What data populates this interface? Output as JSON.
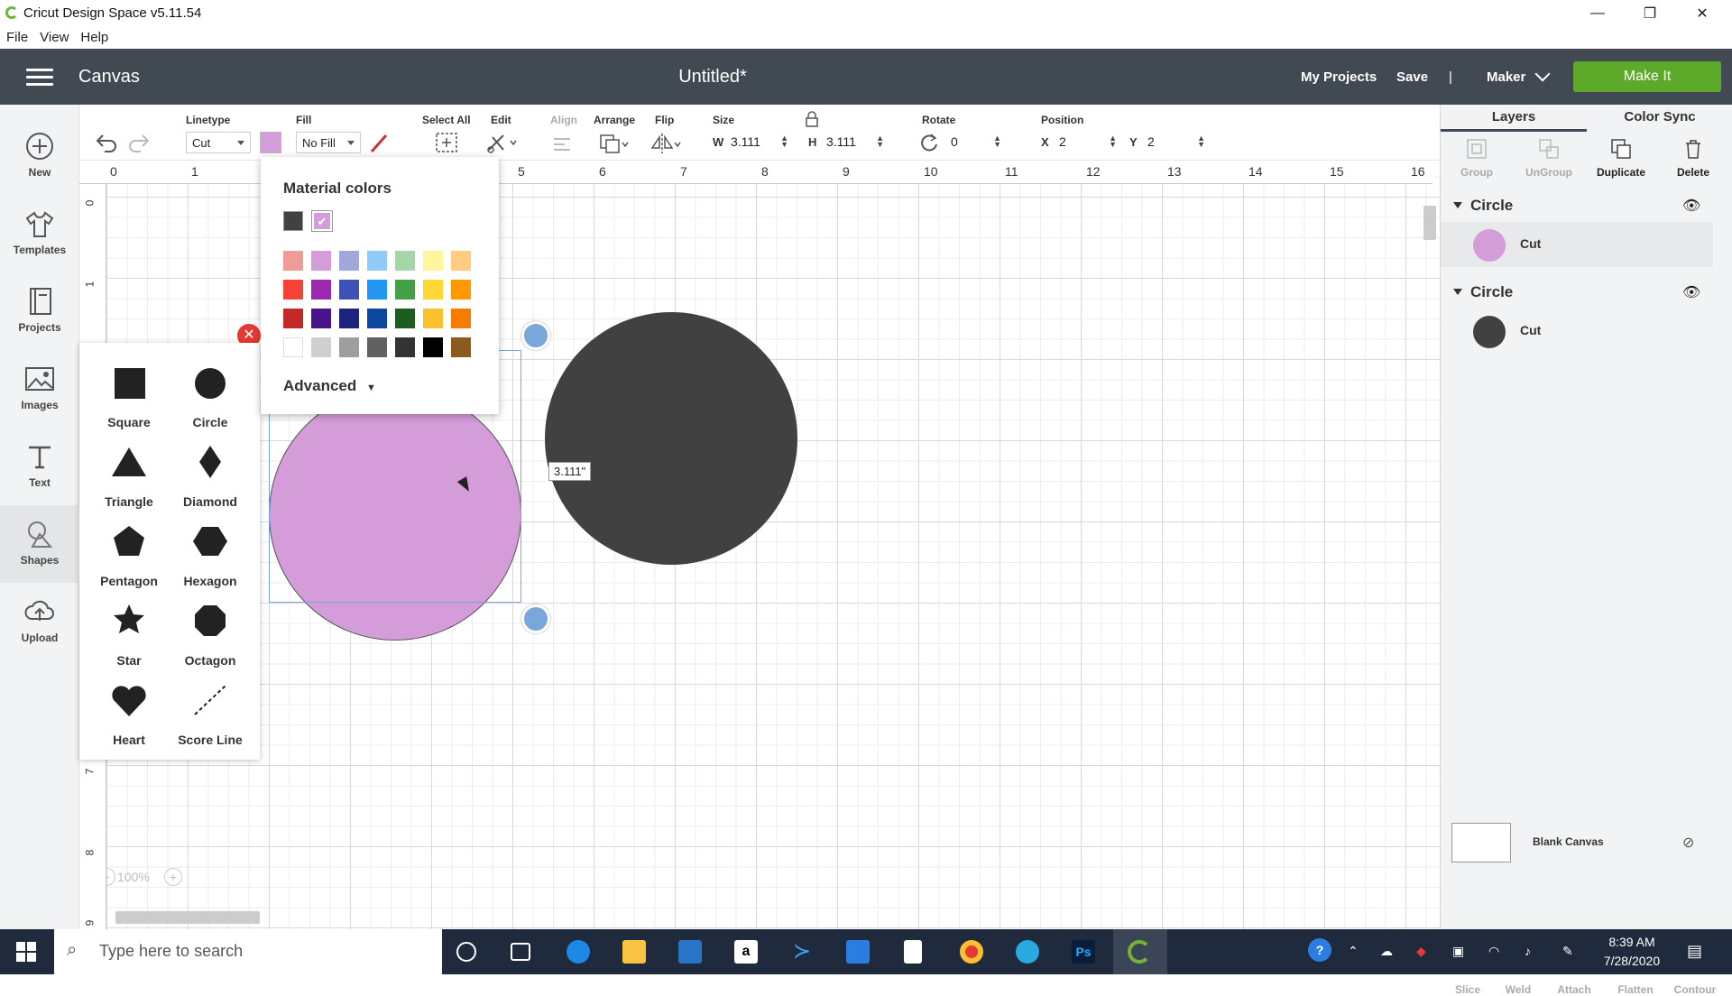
{
  "window": {
    "title": "Cricut Design Space  v5.11.54",
    "minimize": "—",
    "restore": "❐",
    "close": "✕"
  },
  "menu": [
    "File",
    "View",
    "Help"
  ],
  "header": {
    "section": "Canvas",
    "doc_title": "Untitled*",
    "my_projects": "My Projects",
    "save": "Save",
    "separator": "|",
    "machine": "Maker",
    "make_it": "Make It"
  },
  "left_tools": [
    {
      "label": "New",
      "icon": "plus-circle-icon"
    },
    {
      "label": "Templates",
      "icon": "tshirt-icon"
    },
    {
      "label": "Projects",
      "icon": "projects-icon"
    },
    {
      "label": "Images",
      "icon": "image-icon"
    },
    {
      "label": "Text",
      "icon": "text-icon"
    },
    {
      "label": "Shapes",
      "icon": "shapes-icon"
    },
    {
      "label": "Upload",
      "icon": "upload-cloud-icon"
    }
  ],
  "toolbar": {
    "linetype_label": "Linetype",
    "linetype_value": "Cut",
    "fill_label": "Fill",
    "fill_value": "No Fill",
    "select_all": "Select All",
    "edit": "Edit",
    "align": "Align",
    "arrange": "Arrange",
    "flip": "Flip",
    "size_label": "Size",
    "w_label": "W",
    "w_value": "3.111",
    "h_label": "H",
    "h_value": "3.111",
    "rotate_label": "Rotate",
    "rotate_value": "0",
    "position_label": "Position",
    "x_label": "X",
    "x_value": "2",
    "y_label": "Y",
    "y_value": "2",
    "linetype_color": "#d49cd9"
  },
  "ruler": {
    "h": [
      "0",
      "1",
      "5",
      "6",
      "7",
      "8",
      "9",
      "10",
      "11",
      "12",
      "13",
      "14",
      "15",
      "16"
    ],
    "v": [
      "0",
      "1",
      "7",
      "8",
      "9"
    ]
  },
  "canvas": {
    "dimension_label": "3.111\"",
    "zoom": "100%"
  },
  "shapes": [
    {
      "label": "Square",
      "icon": "square-icon"
    },
    {
      "label": "Circle",
      "icon": "circle-icon"
    },
    {
      "label": "Triangle",
      "icon": "triangle-icon"
    },
    {
      "label": "Diamond",
      "icon": "diamond-icon"
    },
    {
      "label": "Pentagon",
      "icon": "pentagon-icon"
    },
    {
      "label": "Hexagon",
      "icon": "hexagon-icon"
    },
    {
      "label": "Star",
      "icon": "star-icon"
    },
    {
      "label": "Octagon",
      "icon": "octagon-icon"
    },
    {
      "label": "Heart",
      "icon": "heart-icon"
    },
    {
      "label": "Score Line",
      "icon": "score-line-icon"
    }
  ],
  "popup": {
    "title": "Material colors",
    "advanced": "Advanced",
    "recent": [
      "#414141",
      "#d49cd9"
    ],
    "palette": [
      [
        "#f09a9a",
        "#d49cd9",
        "#9fa8da",
        "#90caf9",
        "#a5d6a7",
        "#fff59d",
        "#ffcc80"
      ],
      [
        "#f44336",
        "#9c27b0",
        "#3f51b5",
        "#2196f3",
        "#43a047",
        "#fdd835",
        "#ff9800"
      ],
      [
        "#c62828",
        "#4a148c",
        "#1a237e",
        "#0d47a1",
        "#1b5e20",
        "#fbc02d",
        "#f57c00"
      ],
      [
        "#ffffff",
        "#cfcfcf",
        "#9e9e9e",
        "#616161",
        "#333333",
        "#000000",
        "#8d5a1e"
      ]
    ]
  },
  "right_panel": {
    "tab_layers": "Layers",
    "tab_color_sync": "Color Sync",
    "actions": [
      "Group",
      "UnGroup",
      "Duplicate",
      "Delete"
    ],
    "layers": [
      {
        "name": "Circle",
        "item": "Cut",
        "color": "#d49cd9"
      },
      {
        "name": "Circle",
        "item": "Cut",
        "color": "#414141"
      }
    ],
    "blank_canvas": "Blank Canvas",
    "bottom_actions": [
      "Slice",
      "Weld",
      "Attach",
      "Flatten",
      "Contour"
    ]
  },
  "taskbar": {
    "search": "Type here to search",
    "time": "8:39 AM",
    "date": "7/28/2020"
  },
  "colors": {
    "header": "#414a52",
    "make_it": "#5daa2b",
    "circle_pink": "#d49cd9",
    "circle_dark": "#414141",
    "selection": "#7aa7d9"
  }
}
